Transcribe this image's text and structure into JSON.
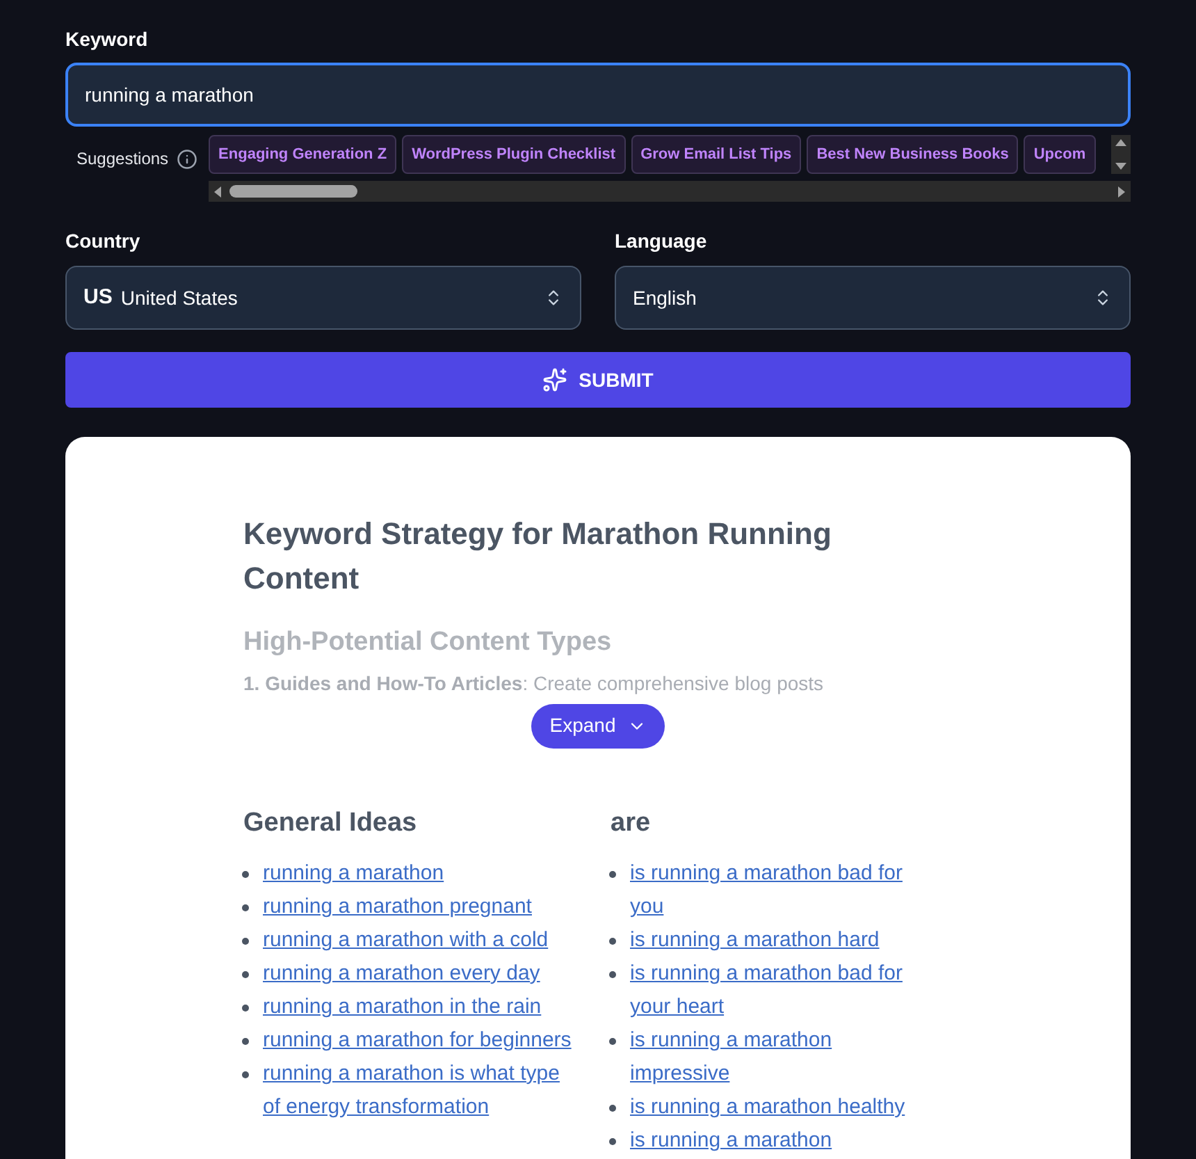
{
  "keyword": {
    "label": "Keyword",
    "value": "running a marathon"
  },
  "suggestions": {
    "label": "Suggestions",
    "chips": [
      "Engaging Generation Z",
      "WordPress Plugin Checklist",
      "Grow Email List Tips",
      "Best New Business Books",
      "Upcom"
    ]
  },
  "country": {
    "label": "Country",
    "code": "US",
    "value": "United States"
  },
  "language": {
    "label": "Language",
    "value": "English"
  },
  "submit": {
    "label": "SUBMIT"
  },
  "result": {
    "title": "Keyword Strategy for Marathon Running Content",
    "subtitle": "High-Potential Content Types",
    "excerpt": "**1. Guides and How-To Articles**: Create comprehensive blog posts",
    "expand": "Expand",
    "groups": [
      {
        "heading": "General Ideas",
        "links": [
          "running a marathon",
          "running a marathon pregnant",
          "running a marathon with a cold",
          "running a marathon every day",
          "running a marathon in the rain",
          "running a marathon for beginners",
          "running a marathon is what type of energy transformation"
        ]
      },
      {
        "heading": "are",
        "links": [
          "is running a marathon bad for you",
          "is running a marathon hard",
          "is running a marathon bad for your heart",
          "is running a marathon impressive",
          "is running a marathon healthy",
          "is running a marathon"
        ]
      }
    ]
  }
}
